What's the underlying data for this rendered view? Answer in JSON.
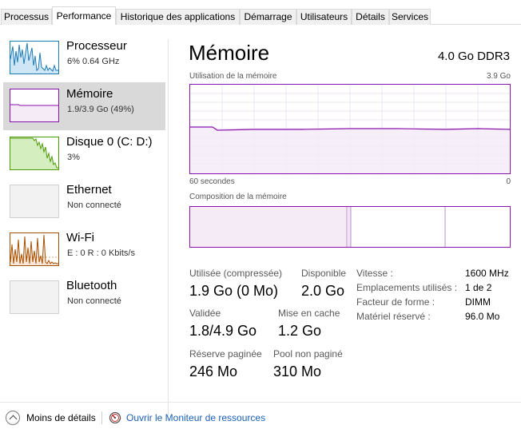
{
  "tabs": [
    {
      "label": "Processus",
      "active": false
    },
    {
      "label": "Performance",
      "active": true
    },
    {
      "label": "Historique des applications",
      "active": false
    },
    {
      "label": "Démarrage",
      "active": false
    },
    {
      "label": "Utilisateurs",
      "active": false
    },
    {
      "label": "Détails",
      "active": false
    },
    {
      "label": "Services",
      "active": false
    }
  ],
  "sidebar": {
    "items": [
      {
        "title": "Processeur",
        "sub": "6% 0.64 GHz",
        "color": "#1a7ab8",
        "fill": "#cfe6f6",
        "icon": "cpu-graph-icon"
      },
      {
        "title": "Mémoire",
        "sub": "1.9/3.9 Go (49%)",
        "color": "#8b12ae",
        "fill": "#f4ebf7",
        "icon": "memory-graph-icon"
      },
      {
        "title": "Disque 0 (C: D:)",
        "sub": "3%",
        "color": "#4d9a06",
        "fill": "#d4eec0",
        "icon": "disk-graph-icon"
      },
      {
        "title": "Ethernet",
        "sub": "Non connecté",
        "color": "#d8d8d8",
        "fill": "#f2f2f2",
        "icon": "ethernet-graph-icon"
      },
      {
        "title": "Wi-Fi",
        "sub": "E : 0 R : 0 Kbits/s",
        "color": "#a74f01",
        "fill": "#f9e8d9",
        "icon": "wifi-graph-icon"
      },
      {
        "title": "Bluetooth",
        "sub": "Non connecté",
        "color": "#d8d8d8",
        "fill": "#f2f2f2",
        "icon": "bluetooth-graph-icon"
      }
    ]
  },
  "main": {
    "title": "Mémoire",
    "spec": "4.0 Go DDR3",
    "usage_label": "Utilisation de la mémoire",
    "usage_max": "3.9 Go",
    "time_left": "60 secondes",
    "time_right": "0",
    "composition_label": "Composition de la mémoire",
    "usage_level_fraction": 0.49,
    "stats": {
      "used_label": "Utilisée (compressée)",
      "used_value": "1.9 Go (0 Mo)",
      "available_label": "Disponible",
      "available_value": "2.0 Go",
      "committed_label": "Validée",
      "committed_value": "1.8/4.9 Go",
      "cached_label": "Mise en cache",
      "cached_value": "1.2 Go",
      "paged_label": "Réserve paginée",
      "paged_value": "246 Mo",
      "nonpaged_label": "Pool non paginé",
      "nonpaged_value": "310 Mo"
    },
    "details": [
      {
        "label": "Vitesse :",
        "value": "1600 MHz"
      },
      {
        "label": "Emplacements utilisés :",
        "value": "1 de 2"
      },
      {
        "label": "Facteur de forme :",
        "value": "DIMM"
      },
      {
        "label": "Matériel réservé :",
        "value": "96.0 Mo"
      }
    ]
  },
  "footer": {
    "fewer_details": "Moins de détails",
    "open_monitor": "Ouvrir le Moniteur de ressources"
  },
  "colors": {
    "memory_accent": "#8b12ae",
    "link": "#1a5fb4"
  }
}
